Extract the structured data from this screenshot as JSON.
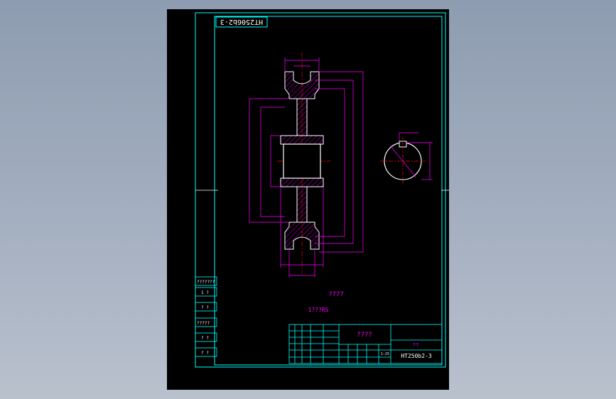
{
  "drawing": {
    "code_rotated": "HT2506b2-3",
    "title_center": "????",
    "note": "????",
    "tech_req": "1???RS",
    "tb_name": "????",
    "tb_material": "??",
    "tb_code": "HT250b2-3",
    "tb_scale": "1:25",
    "side_cells": [
      "???????",
      "1 ?",
      "? ?",
      "?????",
      "? ?",
      "? ?"
    ]
  },
  "colors": {
    "frame": "#00ffff",
    "dim": "#ff00ff",
    "outline": "#ffffff",
    "center": "#ff0000",
    "background": "#000000"
  }
}
